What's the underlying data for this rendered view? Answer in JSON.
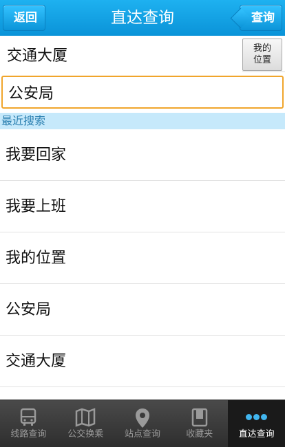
{
  "header": {
    "title": "直达查询",
    "back_label": "返回",
    "query_label": "查询"
  },
  "search": {
    "origin_value": "交通大厦",
    "dest_value": "公安局",
    "my_location_line1": "我的",
    "my_location_line2": "位置"
  },
  "recent": {
    "title": "最近搜索",
    "items": [
      "我要回家",
      "我要上班",
      "我的位置",
      "公安局",
      "交通大厦"
    ]
  },
  "tabbar": {
    "tabs": [
      {
        "label": "线路查询",
        "icon": "bus-icon"
      },
      {
        "label": "公交换乘",
        "icon": "map-icon"
      },
      {
        "label": "站点查询",
        "icon": "location-pin-icon"
      },
      {
        "label": "收藏夹",
        "icon": "bookmark-icon"
      },
      {
        "label": "直达查询",
        "icon": "more-dots-icon"
      }
    ]
  },
  "colors": {
    "header_blue": "#0a93d8",
    "focus_orange": "#f0a52b",
    "section_bg": "#c6e9fb",
    "tabbar_bg": "#2e2e2e",
    "accent_dot": "#41b5ee"
  }
}
